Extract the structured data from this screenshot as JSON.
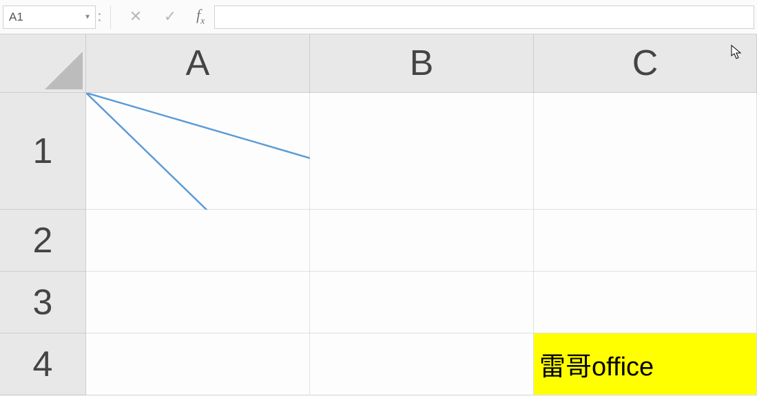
{
  "nameBox": {
    "value": "A1"
  },
  "formula": {
    "value": ""
  },
  "columns": [
    "A",
    "B",
    "C"
  ],
  "rows": [
    "1",
    "2",
    "3",
    "4"
  ],
  "cells": {
    "C4": "雷哥office"
  },
  "colors": {
    "highlight": "#ffff00",
    "diagonalLine": "#5b9bd5"
  }
}
